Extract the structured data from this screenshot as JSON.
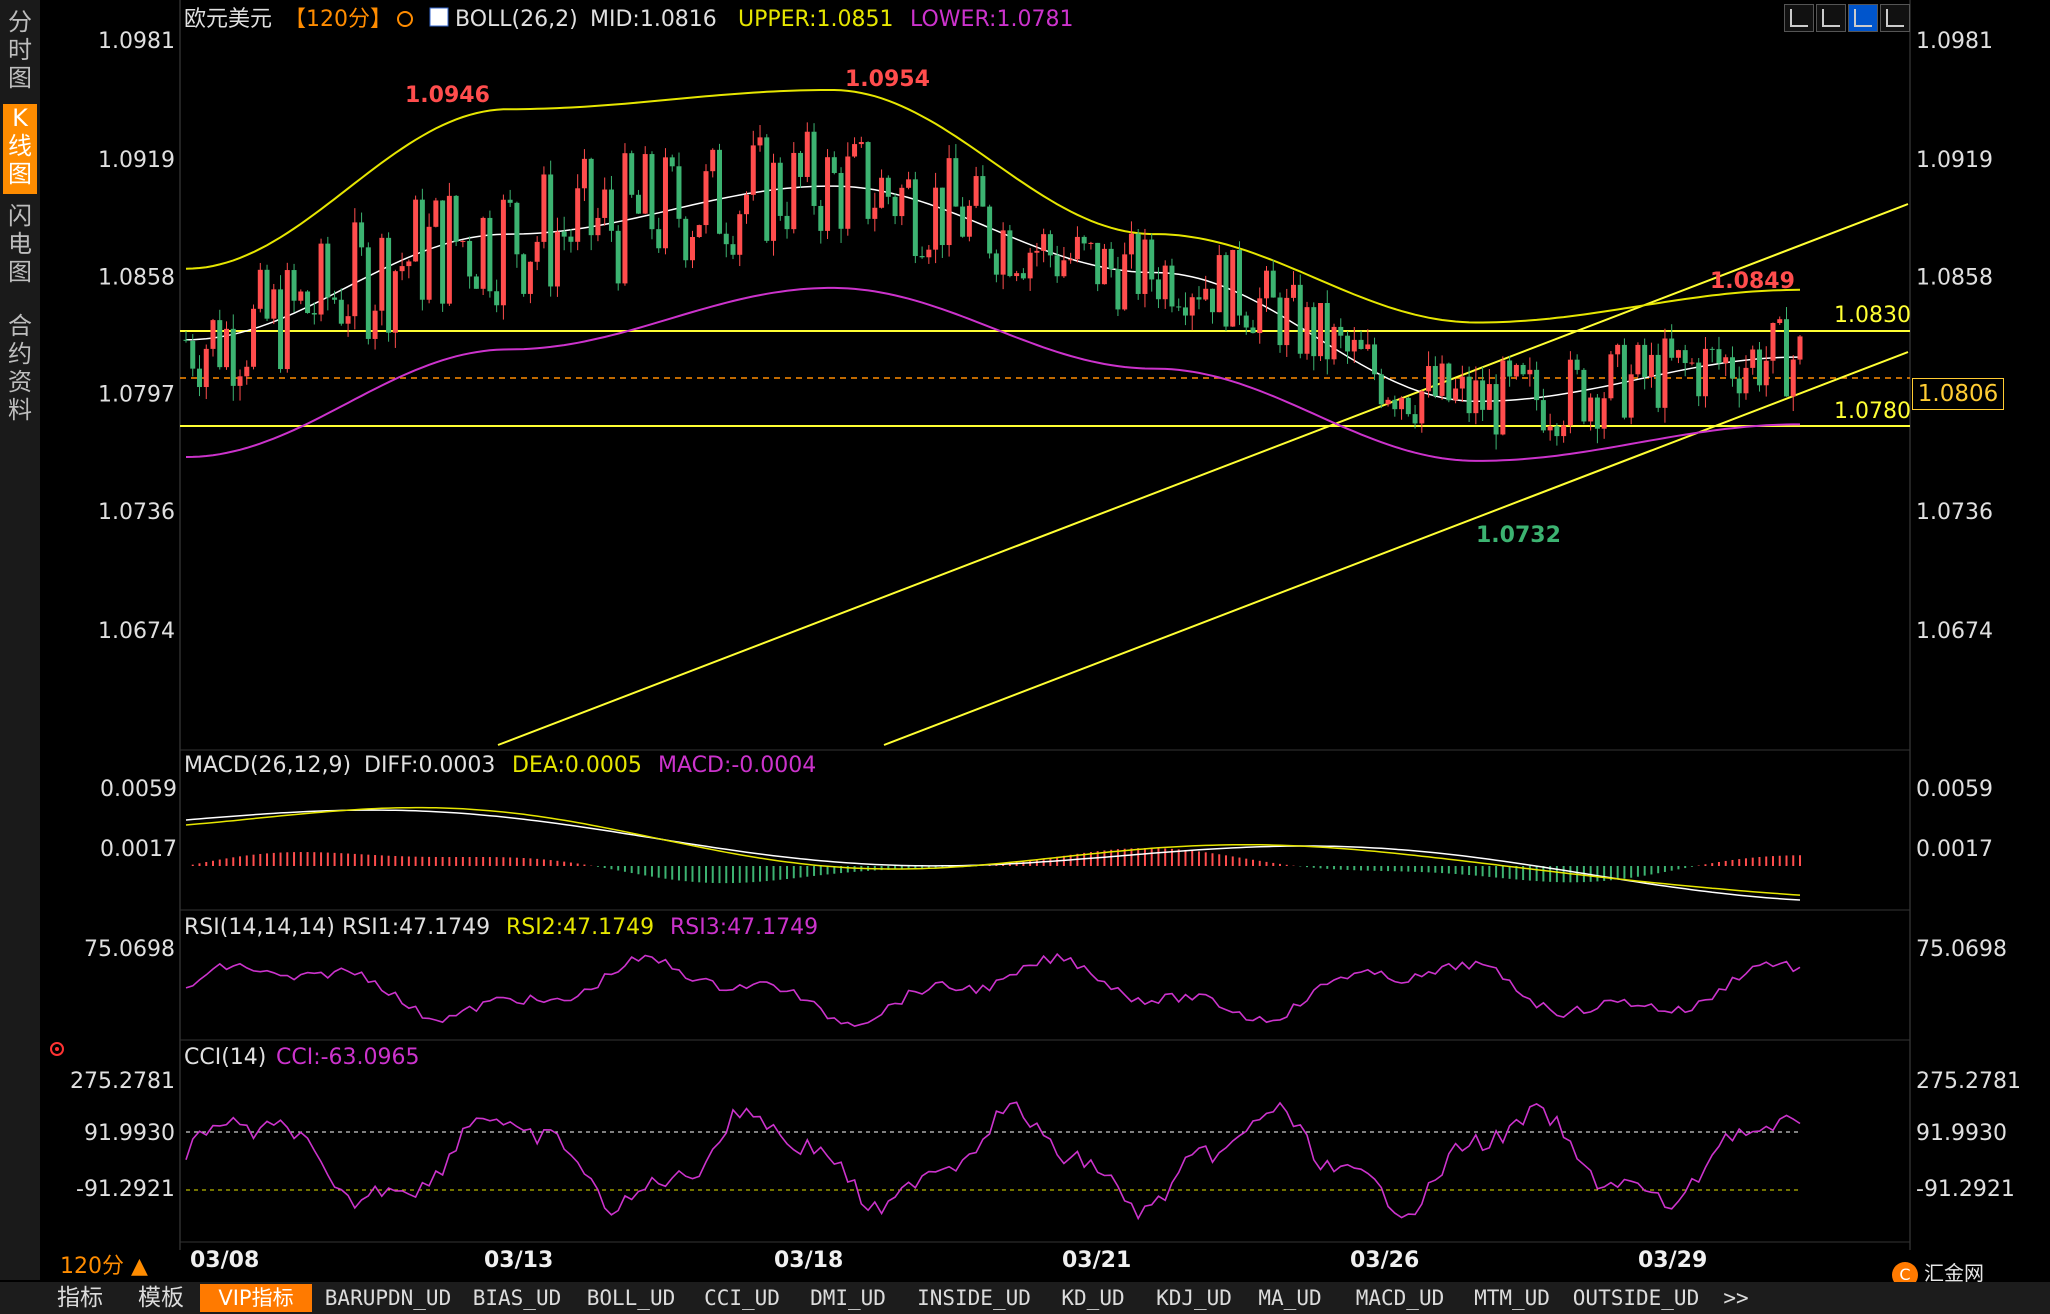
{
  "header": {
    "instrument": "欧元美元",
    "period": "【120分】",
    "indicator": "BOLL(26,2)",
    "mid": "MID:1.0816",
    "upper": "UPPER:1.0851",
    "lower": "LOWER:1.0781"
  },
  "sidebar": {
    "tabs": [
      {
        "label": "分时图",
        "active": false
      },
      {
        "label": "K线图",
        "active": true
      },
      {
        "label": "闪电图",
        "active": false
      },
      {
        "label": "合约资料",
        "active": false
      }
    ]
  },
  "price_axis": {
    "ticks": [
      "1.0981",
      "1.0919",
      "1.0858",
      "1.0797",
      "1.0736",
      "1.0674"
    ],
    "values": [
      1.0981,
      1.0919,
      1.0858,
      1.0797,
      1.0736,
      1.0674
    ],
    "current": "1.0806"
  },
  "annotations": {
    "high1": "1.0946",
    "high2": "1.0954",
    "high3": "1.0849",
    "low1": "1.0732",
    "resistance": "1.0830",
    "support": "1.0780"
  },
  "macd": {
    "title": "MACD(26,12,9)",
    "diff": "DIFF:0.0003",
    "dea": "DEA:0.0005",
    "macd": "MACD:-0.0004",
    "ticks": [
      "0.0059",
      "0.0017"
    ]
  },
  "rsi": {
    "title": "RSI(14,14,14)",
    "rsi1": "RSI1:47.1749",
    "rsi2": "RSI2:47.1749",
    "rsi3": "RSI3:47.1749",
    "ticks": [
      "75.0698"
    ]
  },
  "cci": {
    "title": "CCI(14)",
    "value": "CCI:-63.0965",
    "ticks": [
      "275.2781",
      "91.9930",
      "-91.2921"
    ]
  },
  "dates": [
    "03/08",
    "03/13",
    "03/18",
    "03/21",
    "03/26",
    "03/29"
  ],
  "period_label": "120分 ▲",
  "bottom_tabs": [
    "指标",
    "模板",
    "VIP指标",
    "BARUPDN_UD",
    "BIAS_UD",
    "BOLL_UD",
    "CCI_UD",
    "DMI_UD",
    "INSIDE_UD",
    "KD_UD",
    "KDJ_UD",
    "MA_UD",
    "MACD_UD",
    "MTM_UD",
    "OUTSIDE_UD",
    ">>"
  ],
  "logo_text": "汇金网",
  "colors": {
    "up": "#ff4d4d",
    "down": "#3cb371",
    "boll_mid": "#ffffff",
    "boll_upper": "#e6e600",
    "boll_lower": "#cc33cc",
    "trend": "#ffff33",
    "accent": "#ff8c00"
  },
  "chart_data": {
    "type": "line",
    "title": "欧元美元 120分",
    "x": [
      "03/08",
      "03/13",
      "03/18",
      "03/21",
      "03/26",
      "03/29"
    ],
    "series": [
      {
        "name": "MID",
        "values": [
          1.0825,
          1.088,
          1.0905,
          1.086,
          1.0793,
          1.0816
        ]
      },
      {
        "name": "UPPER",
        "values": [
          1.0862,
          1.0945,
          1.0955,
          1.088,
          1.0834,
          1.0851
        ]
      },
      {
        "name": "LOWER",
        "values": [
          1.0764,
          1.082,
          1.0852,
          1.081,
          1.0762,
          1.0781
        ]
      }
    ],
    "ylim": [
      1.066,
      1.099
    ],
    "horizontal_lines": [
      1.083,
      1.078
    ],
    "grid": false
  }
}
